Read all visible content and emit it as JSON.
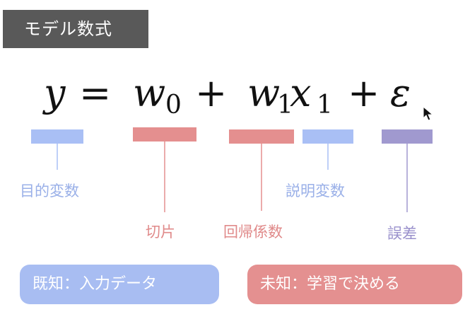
{
  "header": {
    "title": "モデル数式"
  },
  "equation": {
    "y": "y",
    "equals": "=",
    "w0": "w",
    "w0_sub": "0",
    "plus1": "+",
    "w1": "w",
    "w1_sub": "1",
    "x1": "x",
    "x1_sub": "1",
    "plus2": "+",
    "epsilon": "ε"
  },
  "labels": {
    "target": "目的変数",
    "intercept": "切片",
    "coefficient": "回帰係数",
    "explanatory": "説明変数",
    "error": "誤差"
  },
  "legend": {
    "known": "既知：入力データ",
    "unknown": "未知：学習で決める"
  },
  "colors": {
    "blue_bar": "#a9bff5",
    "red_bar": "#e48f8f",
    "purple_bar": "#a099cf",
    "blue_text": "#9ab0e8",
    "red_text": "#e08a8a",
    "purple_text": "#9a91cc",
    "blue_pill": "#a8bdf2",
    "red_pill": "#e49090",
    "title_bg": "#595959"
  }
}
